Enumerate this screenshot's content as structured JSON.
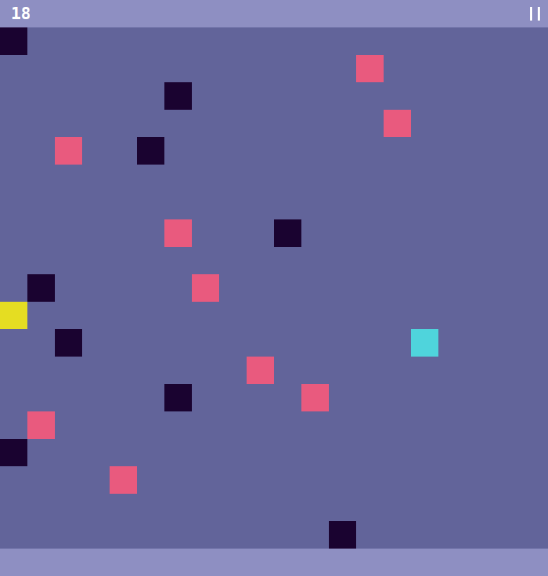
{
  "score": "18",
  "board": {
    "columns": 20,
    "rows": 19,
    "blocks": [
      {
        "kind": "wall",
        "col": 0,
        "row": 0,
        "color": "#1a0330"
      },
      {
        "kind": "wall",
        "col": 6,
        "row": 2,
        "color": "#1a0330"
      },
      {
        "kind": "wall",
        "col": 5,
        "row": 4,
        "color": "#1a0330"
      },
      {
        "kind": "wall",
        "col": 10,
        "row": 7,
        "color": "#1a0330"
      },
      {
        "kind": "wall",
        "col": 1,
        "row": 9,
        "color": "#1a0330"
      },
      {
        "kind": "wall",
        "col": 2,
        "row": 11,
        "color": "#1a0330"
      },
      {
        "kind": "wall",
        "col": 6,
        "row": 13,
        "color": "#1a0330"
      },
      {
        "kind": "wall",
        "col": 0,
        "row": 15,
        "color": "#1a0330"
      },
      {
        "kind": "wall",
        "col": 12,
        "row": 18,
        "color": "#1a0330"
      },
      {
        "kind": "hazard",
        "col": 13,
        "row": 1,
        "color": "#e95a7e"
      },
      {
        "kind": "hazard",
        "col": 14,
        "row": 3,
        "color": "#e95a7e"
      },
      {
        "kind": "hazard",
        "col": 2,
        "row": 4,
        "color": "#e95a7e"
      },
      {
        "kind": "hazard",
        "col": 6,
        "row": 7,
        "color": "#e95a7e"
      },
      {
        "kind": "hazard",
        "col": 7,
        "row": 9,
        "color": "#e95a7e"
      },
      {
        "kind": "hazard",
        "col": 9,
        "row": 12,
        "color": "#e95a7e"
      },
      {
        "kind": "hazard",
        "col": 11,
        "row": 13,
        "color": "#e95a7e"
      },
      {
        "kind": "hazard",
        "col": 1,
        "row": 14,
        "color": "#e95a7e"
      },
      {
        "kind": "hazard",
        "col": 4,
        "row": 16,
        "color": "#e95a7e"
      },
      {
        "kind": "player",
        "col": 0,
        "row": 10,
        "color": "#e5dd22"
      },
      {
        "kind": "goal",
        "col": 15,
        "row": 11,
        "color": "#4fd4dc"
      }
    ]
  }
}
